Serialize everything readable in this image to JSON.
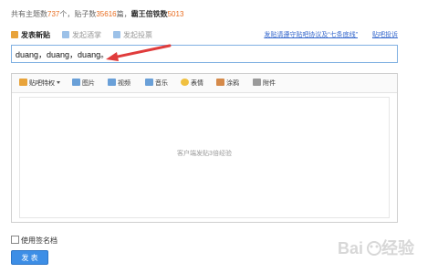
{
  "stats": {
    "topics_label": "共有主题数",
    "topics_value": "737",
    "topics_sep": "个，贴子数",
    "posts_value": "35616",
    "posts_sep": "篇，",
    "members_label": "霸王倍铁数",
    "members_value": "5013"
  },
  "tabs": [
    {
      "label": "发表新贴",
      "active": true,
      "icon_color": "#e8a33a",
      "icon": "pencil-icon"
    },
    {
      "label": "发起酒掌",
      "active": false,
      "icon_color": "#9cc1e8",
      "icon": "image-icon"
    },
    {
      "label": "发起投票",
      "active": false,
      "icon_color": "#9cc1e8",
      "icon": "vote-icon"
    }
  ],
  "header_links": {
    "rules": "发贴请遵守贴吧协议及“七条底线”",
    "feedback": "贴吧投诉"
  },
  "title_input": {
    "value": "duang，duang，duang。"
  },
  "toolbar": {
    "items": [
      {
        "label": "贴吧特权",
        "icon": "crown-icon",
        "icon_color": "#e8a33a",
        "dropdown": true
      },
      {
        "label": "图片",
        "icon": "picture-icon",
        "icon_color": "#6aa0d8"
      },
      {
        "label": "视频",
        "icon": "video-icon",
        "icon_color": "#6aa0d8"
      },
      {
        "label": "音乐",
        "icon": "music-icon",
        "icon_color": "#6aa0d8"
      },
      {
        "label": "表情",
        "icon": "smiley-icon",
        "icon_color": "#f0c040"
      },
      {
        "label": "涂鸦",
        "icon": "brush-icon",
        "icon_color": "#d58a4a"
      },
      {
        "label": "附件",
        "icon": "attachment-icon",
        "icon_color": "#9a9a9a"
      }
    ]
  },
  "editor": {
    "placeholder": "客户端发贴3倍经验"
  },
  "signature": {
    "label": "使用签名档"
  },
  "publish_button": {
    "label": "发 表"
  },
  "colors": {
    "accent": "#3d8ee6",
    "arrow": "#e03c3c",
    "stat_number": "#e86c1f"
  }
}
